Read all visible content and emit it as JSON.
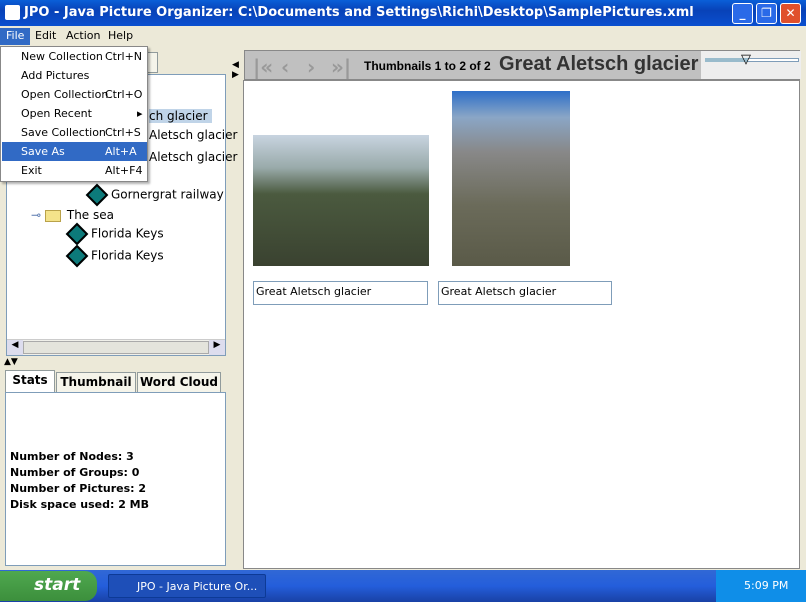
{
  "window": {
    "title": "JPO - Java Picture Organizer:  C:\\Documents and Settings\\Richi\\Desktop\\SamplePictures.xml"
  },
  "menubar": [
    "File",
    "Edit",
    "Action",
    "Help"
  ],
  "file_menu": [
    {
      "label": "New Collection",
      "shortcut": "Ctrl+N"
    },
    {
      "label": "Add Pictures",
      "shortcut": ""
    },
    {
      "label": "Open Collection",
      "shortcut": "Ctrl+O"
    },
    {
      "label": "Open Recent",
      "shortcut": "▸"
    },
    {
      "label": "Save Collection",
      "shortcut": "Ctrl+S"
    },
    {
      "label": "Save As",
      "shortcut": "Alt+A",
      "selected": true
    },
    {
      "label": "Exit",
      "shortcut": "Alt+F4"
    }
  ],
  "tree": {
    "visible_fragments": [
      "ch glacier",
      "Aletsch glacier",
      "Aletsch glacier"
    ],
    "items": [
      "Gornergrat railway",
      "The sea",
      "Florida Keys",
      "Florida Keys"
    ]
  },
  "bottom_tabs": [
    "Stats",
    "Thumbnail",
    "Word Cloud"
  ],
  "stats": [
    "Number of Nodes: 3",
    "Number of Groups: 0",
    "Number of Pictures: 2",
    "Disk space used: 2 MB"
  ],
  "toolbar": {
    "count": "Thumbnails 1 to 2 of 2",
    "title": "Great Aletsch glacier",
    "zoom_slider": 0.45
  },
  "thumbnails": [
    {
      "caption": "Great Aletsch glacier"
    },
    {
      "caption": "Great Aletsch glacier"
    }
  ],
  "taskbar": {
    "start": "start",
    "task": "JPO - Java Picture Or...",
    "clock": "5:09 PM"
  }
}
